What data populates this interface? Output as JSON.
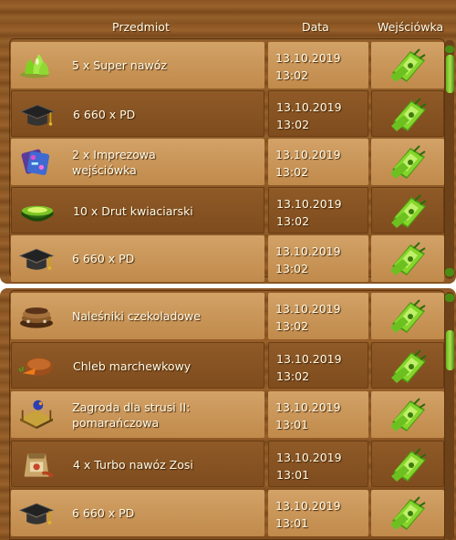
{
  "header": {
    "item_label": "Przedmiot",
    "date_label": "Data",
    "ticket_label": "Wejściówka"
  },
  "panel1": {
    "rows": [
      {
        "icon": "fertilizer-drops-icon",
        "name": "5 x Super nawóz",
        "date": "13.10.2019",
        "time": "13:02"
      },
      {
        "icon": "graduation-cap-icon",
        "name": "6 660 x PD",
        "date": "13.10.2019",
        "time": "13:02"
      },
      {
        "icon": "party-ticket-icon",
        "name": "2 x Imprezowa\nwejściówka",
        "date": "13.10.2019",
        "time": "13:02"
      },
      {
        "icon": "wire-bowl-icon",
        "name": "10 x Drut kwiaciarski",
        "date": "13.10.2019",
        "time": "13:02"
      },
      {
        "icon": "graduation-cap-icon",
        "name": "6 660 x PD",
        "date": "13.10.2019",
        "time": "13:02"
      }
    ]
  },
  "panel2": {
    "rows": [
      {
        "icon": "pancakes-icon",
        "name": "Naleśniki czekoladowe",
        "date": "13.10.2019",
        "time": "13:02"
      },
      {
        "icon": "bread-icon",
        "name": "Chleb marchewkowy",
        "date": "13.10.2019",
        "time": "13:02"
      },
      {
        "icon": "ostrich-enclosure-icon",
        "name": "Zagroda dla strusi II:\npomarańczowa",
        "date": "13.10.2019",
        "time": "13:01"
      },
      {
        "icon": "fertilizer-bag-icon",
        "name": "4 x Turbo nawóz Zosi",
        "date": "13.10.2019",
        "time": "13:01"
      },
      {
        "icon": "graduation-cap-icon",
        "name": "6 660 x PD",
        "date": "13.10.2019",
        "time": "13:01"
      }
    ]
  },
  "colors": {
    "wood": "#8a5422",
    "light_cell": "#c79453",
    "text": "#fffbe6",
    "ticket_green": "#7fd026"
  }
}
